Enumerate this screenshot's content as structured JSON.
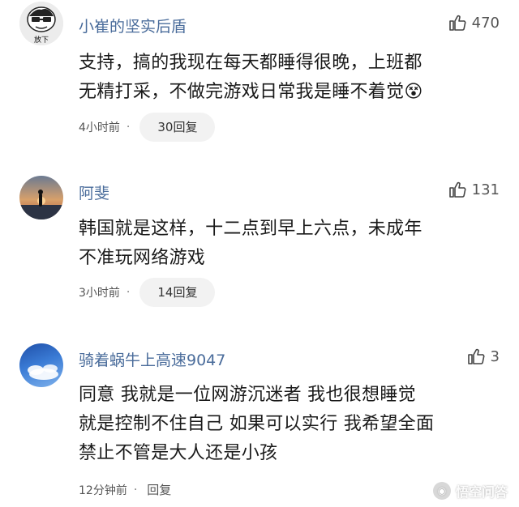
{
  "comments": [
    {
      "username": "小崔的坚实后盾",
      "likes": "470",
      "content_lines": [
        "支持，搞的我现在每天都睡得很晚，上班都",
        "无精打采，不做完游戏日常我是睡不着觉😵"
      ],
      "time": "4小时前",
      "reply": "30回复"
    },
    {
      "username": "阿斐",
      "likes": "131",
      "content_lines": [
        "韩国就是这样，十二点到早上六点，未成年",
        "不准玩网络游戏"
      ],
      "time": "3小时前",
      "reply": "14回复"
    },
    {
      "username": "骑着蜗牛上高速9047",
      "likes": "3",
      "content_lines": [
        "同意 我就是一位网游沉迷者 我也很想睡觉",
        "就是控制不住自己 如果可以实行 我希望全面",
        "禁止不管是大人还是小孩"
      ],
      "time": "12分钟前",
      "reply": "回复"
    }
  ],
  "separator": "·",
  "avatar_text": "放下",
  "watermark": {
    "text": "悟空问答"
  },
  "icons": {
    "like": "thumbs-up-icon",
    "logo": "wukong-logo"
  }
}
